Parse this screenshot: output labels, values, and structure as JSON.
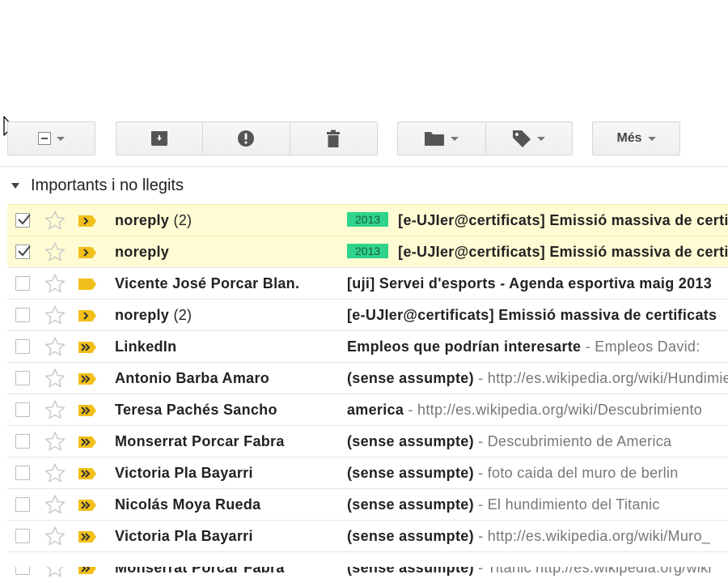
{
  "toolbar": {
    "more_label": "Més",
    "icons": {
      "select": "select-all-checkbox-icon",
      "archive": "archive-icon",
      "spam": "report-spam-icon",
      "delete": "trash-icon",
      "move": "folder-icon",
      "labels": "tag-icon"
    }
  },
  "section": {
    "title": "Importants i no llegits"
  },
  "colors": {
    "selected_row": "#fffcd4",
    "label_bg": "#2fd38b",
    "importance_marker": "#f2c01c"
  },
  "emails": [
    {
      "checked": true,
      "starred": false,
      "importance": "single",
      "state": "selected",
      "sender": "noreply",
      "count": "(2)",
      "label": "2013",
      "subject": "[e-UJIer@certificats] Emissió massiva de certificats",
      "snippet": ""
    },
    {
      "checked": true,
      "starred": false,
      "importance": "single",
      "state": "selected",
      "sender": "noreply",
      "count": "",
      "label": "2013",
      "subject": "[e-UJIer@certificats] Emissió massiva de certificats",
      "snippet": ""
    },
    {
      "checked": false,
      "starred": false,
      "importance": "plain",
      "state": "unread",
      "sender": "Vicente José Porcar Blan.",
      "count": "",
      "label": "",
      "subject": "[uji] Servei d'esports - Agenda esportiva maig 2013",
      "snippet": ""
    },
    {
      "checked": false,
      "starred": false,
      "importance": "single",
      "state": "unread",
      "sender": "noreply",
      "count": "(2)",
      "label": "",
      "subject": "[e-UJIer@certificats] Emissió massiva de certificats",
      "snippet": ""
    },
    {
      "checked": false,
      "starred": false,
      "importance": "double",
      "state": "unread",
      "sender": "LinkedIn",
      "count": "",
      "label": "",
      "subject": "Empleos que podrían interesarte",
      "snippet": " - Empleos David:"
    },
    {
      "checked": false,
      "starred": false,
      "importance": "double",
      "state": "unread",
      "sender": "Antonio Barba Amaro",
      "count": "",
      "label": "",
      "subject": "(sense assumpte)",
      "snippet": " - http://es.wikipedia.org/wiki/Hundimiento"
    },
    {
      "checked": false,
      "starred": false,
      "importance": "double",
      "state": "unread",
      "sender": "Teresa Pachés Sancho",
      "count": "",
      "label": "",
      "subject": "america",
      "snippet": " - http://es.wikipedia.org/wiki/Descubrimiento"
    },
    {
      "checked": false,
      "starred": false,
      "importance": "double",
      "state": "unread",
      "sender": "Monserrat Porcar Fabra",
      "count": "",
      "label": "",
      "subject": "(sense assumpte)",
      "snippet": " - Descubrimiento de America"
    },
    {
      "checked": false,
      "starred": false,
      "importance": "double",
      "state": "unread",
      "sender": "Victoria Pla Bayarri",
      "count": "",
      "label": "",
      "subject": "(sense assumpte)",
      "snippet": " - foto caida del muro de berlin"
    },
    {
      "checked": false,
      "starred": false,
      "importance": "double",
      "state": "unread",
      "sender": "Nicolás Moya Rueda",
      "count": "",
      "label": "",
      "subject": "(sense assumpte)",
      "snippet": " - El hundimiento del Titanic"
    },
    {
      "checked": false,
      "starred": false,
      "importance": "double",
      "state": "unread",
      "sender": "Victoria Pla Bayarri",
      "count": "",
      "label": "",
      "subject": "(sense assumpte)",
      "snippet": " - http://es.wikipedia.org/wiki/Muro_"
    },
    {
      "checked": false,
      "starred": false,
      "importance": "double",
      "state": "unread",
      "sender": "Monserrat Porcar Fabra",
      "count": "",
      "label": "",
      "subject": "(sense assumpte)",
      "snippet": " - Titanic http://es.wikipedia.org/wiki"
    }
  ]
}
